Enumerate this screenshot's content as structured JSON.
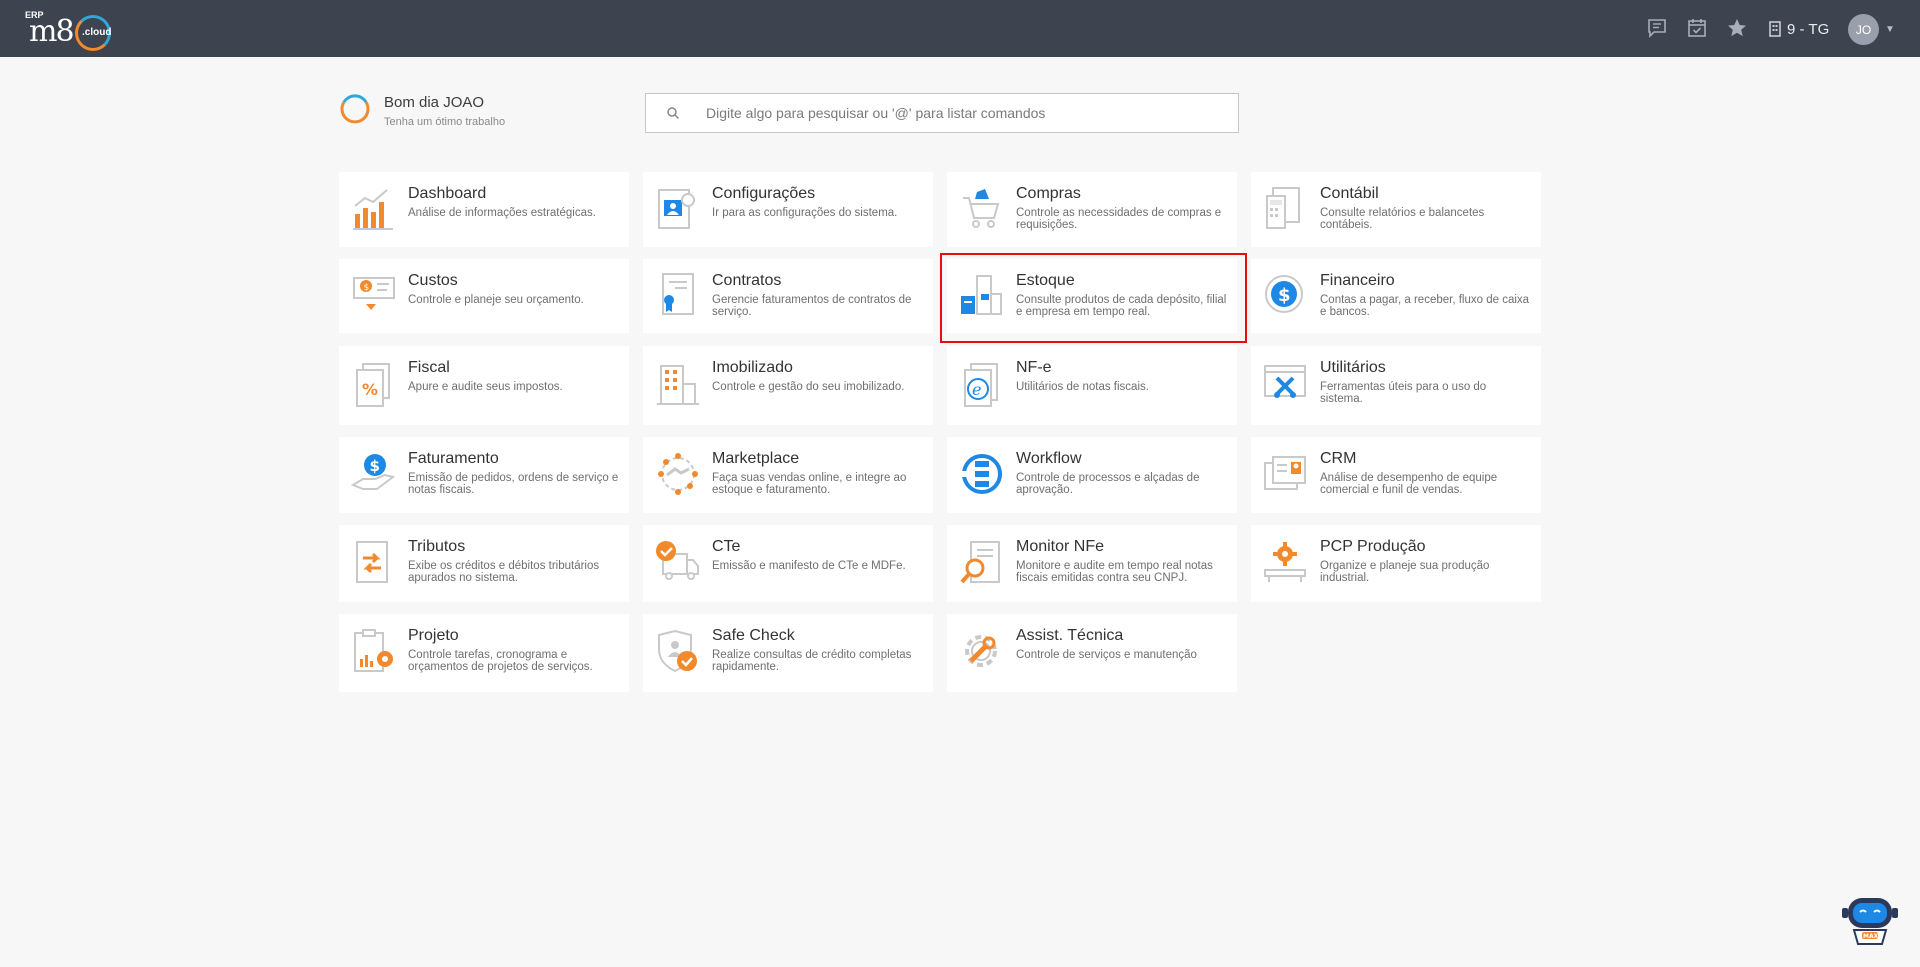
{
  "topbar": {
    "logo_erp": "ERP",
    "logo_m8": "m8",
    "logo_cloud": ".cloud",
    "icons": [
      "chat-icon",
      "calendar-icon",
      "star-icon"
    ],
    "company": "9 - TG",
    "user_initials": "JO",
    "colors": {
      "background": "#3e4350"
    }
  },
  "greeting": {
    "title": "Bom dia JOAO",
    "subtitle": "Tenha um ótimo trabalho"
  },
  "search": {
    "placeholder": "Digite algo para pesquisar ou '@' para listar comandos",
    "value": ""
  },
  "modules": [
    {
      "title": "Dashboard",
      "desc": "Análise de informações estratégicas.",
      "icon": "dashboard-chart-icon"
    },
    {
      "title": "Configurações",
      "desc": "Ir para as configurações do sistema.",
      "icon": "settings-profile-icon"
    },
    {
      "title": "Compras",
      "desc": "Controle as necessidades de compras e requisições.",
      "icon": "shopping-cart-icon"
    },
    {
      "title": "Contábil",
      "desc": "Consulte relatórios e balancetes contábeis.",
      "icon": "accounting-calculator-icon"
    },
    {
      "title": "Custos",
      "desc": "Controle e planeje seu orçamento.",
      "icon": "costs-money-icon"
    },
    {
      "title": "Contratos",
      "desc": "Gerencie faturamentos de contratos de serviço.",
      "icon": "contract-document-icon"
    },
    {
      "title": "Estoque",
      "desc": "Consulte produtos de cada depósito, filial e empresa em tempo real.",
      "icon": "warehouse-boxes-icon"
    },
    {
      "title": "Financeiro",
      "desc": "Contas a pagar, a receber, fluxo de caixa e bancos.",
      "icon": "dollar-coin-icon"
    },
    {
      "title": "Fiscal",
      "desc": "Apure e audite seus impostos.",
      "icon": "tax-percent-icon"
    },
    {
      "title": "Imobilizado",
      "desc": "Controle e gestão do seu imobilizado.",
      "icon": "building-asset-icon"
    },
    {
      "title": "NF-e",
      "desc": "Utilitários de notas fiscais.",
      "icon": "electronic-invoice-icon"
    },
    {
      "title": "Utilitários",
      "desc": "Ferramentas úteis para o uso do sistema.",
      "icon": "tools-wrench-icon"
    },
    {
      "title": "Faturamento",
      "desc": "Emissão de pedidos, ordens de serviço e notas fiscais.",
      "icon": "billing-hand-dollar-icon"
    },
    {
      "title": "Marketplace",
      "desc": "Faça suas vendas online, e integre ao estoque e faturamento.",
      "icon": "marketplace-handshake-icon"
    },
    {
      "title": "Workflow",
      "desc": "Controle de processos e alçadas de aprovação.",
      "icon": "workflow-cycle-icon"
    },
    {
      "title": "CRM",
      "desc": "Análise de desempenho de equipe comercial e funil de vendas.",
      "icon": "crm-contact-card-icon"
    },
    {
      "title": "Tributos",
      "desc": "Exibe os créditos e débitos tributários apurados no sistema.",
      "icon": "tributes-exchange-icon"
    },
    {
      "title": "CTe",
      "desc": "Emissão e manifesto de CTe e MDFe.",
      "icon": "truck-check-icon"
    },
    {
      "title": "Monitor NFe",
      "desc": "Monitore e audite em tempo real notas fiscais emitidas contra seu CNPJ.",
      "icon": "magnifier-document-icon"
    },
    {
      "title": "PCP Produção",
      "desc": "Organize e planeje sua produção industrial.",
      "icon": "production-gear-icon"
    },
    {
      "title": "Projeto",
      "desc": "Controle tarefas, cronograma e orçamentos de projetos de serviços.",
      "icon": "project-clipboard-icon"
    },
    {
      "title": "Safe Check",
      "desc": "Realize consultas de crédito completas rapidamente.",
      "icon": "shield-check-icon"
    },
    {
      "title": "Assist. Técnica",
      "desc": "Controle de serviços e manutenção",
      "icon": "gear-wrench-icon"
    }
  ],
  "highlighted_module": "Estoque",
  "assistant": {
    "label": "MAX"
  },
  "colors": {
    "accent_orange": "#f08a2c",
    "accent_blue": "#1e88e5",
    "highlight_red": "#e01010"
  }
}
